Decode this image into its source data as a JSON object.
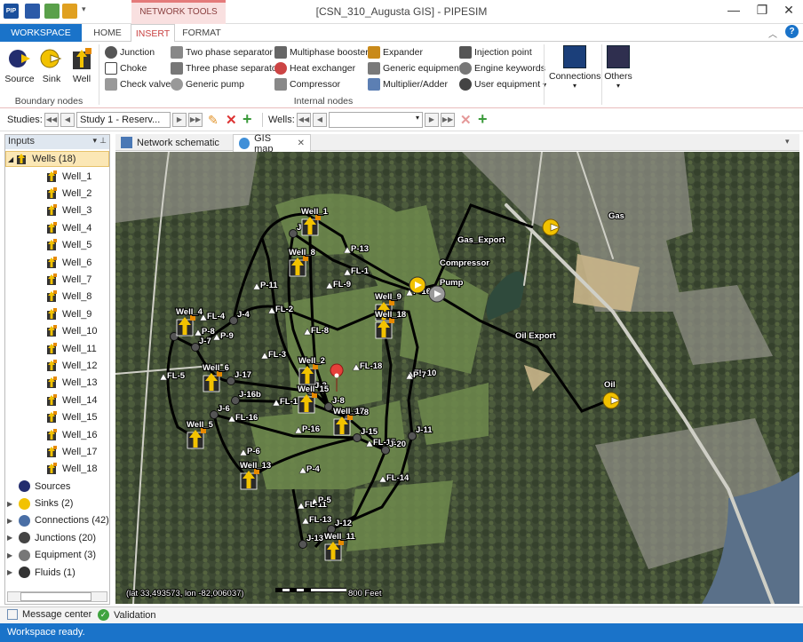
{
  "window": {
    "title": "[CSN_310_Augusta GIS] - PIPESIM",
    "context_tab": "NETWORK TOOLS"
  },
  "ribbon_tabs": [
    "WORKSPACE",
    "HOME",
    "INSERT",
    "FORMAT"
  ],
  "boundary_nodes": {
    "label": "Boundary nodes",
    "items": [
      "Source",
      "Sink",
      "Well"
    ]
  },
  "internal_nodes": {
    "label": "Internal nodes",
    "col1": [
      "Junction",
      "Choke",
      "Check valve"
    ],
    "col2": [
      "Two phase separator",
      "Three phase separator",
      "Generic pump"
    ],
    "col3": [
      "Multiphase booster",
      "Heat exchanger",
      "Compressor"
    ],
    "col4": [
      "Expander",
      "Generic equipment",
      "Multiplier/Adder"
    ],
    "col5": [
      "Injection point",
      "Engine keywords",
      "User equipment"
    ]
  },
  "connections_label": "Connections",
  "others_label": "Others",
  "studybar": {
    "studies_label": "Studies:",
    "study_value": "Study 1 - Reserv...",
    "wells_label": "Wells:",
    "wells_value": ""
  },
  "inputs": {
    "title": "Inputs",
    "wells_header": "Wells (18)",
    "wells": [
      "Well_1",
      "Well_2",
      "Well_3",
      "Well_4",
      "Well_5",
      "Well_6",
      "Well_7",
      "Well_8",
      "Well_9",
      "Well_10",
      "Well_11",
      "Well_12",
      "Well_13",
      "Well_14",
      "Well_15",
      "Well_16",
      "Well_17",
      "Well_18"
    ],
    "groups": [
      "Sources",
      "Sinks (2)",
      "Connections (42)",
      "Junctions (20)",
      "Equipment (3)",
      "Fluids (1)"
    ]
  },
  "doc_tabs": [
    "Network schematic",
    "GIS map"
  ],
  "map": {
    "coords": "(lat 33,493573, lon -82,006037)",
    "scale": "800 Feet",
    "labels": {
      "gas": "Gas",
      "gas_export": "Gas_Export",
      "compressor": "Compressor",
      "pump": "Pump",
      "oil_export": "Oil Export",
      "oil": "Oil"
    },
    "well_labels": [
      "Well_1",
      "Well_8",
      "Well_9",
      "Well_18",
      "Well_4",
      "Well_6",
      "Well_2",
      "Well_17",
      "Well_15",
      "Well_5",
      "Well_13",
      "Well_11"
    ],
    "junction_labels": [
      "J-2",
      "J-4",
      "J-5",
      "J-7",
      "J-17",
      "J-16b",
      "J-6",
      "J-3",
      "J-8",
      "J-18",
      "J-15",
      "J-11",
      "J-20",
      "J-12",
      "J-13"
    ],
    "pipe_labels": [
      "P-13",
      "FL-1",
      "P-11",
      "FL-9",
      "FL-2",
      "P-16",
      "FL-4",
      "P-8",
      "P-9",
      "FL-8",
      "FL-3",
      "FL-5",
      "FL-18",
      "FL-10",
      "P-7",
      "FL-17",
      "FL-16",
      "P-16",
      "FL-15",
      "P-6",
      "P-4",
      "FL-14",
      "FL-11",
      "FL-13",
      "P-5"
    ]
  },
  "bottom_tabs": [
    "Message center",
    "Validation"
  ],
  "status": "Workspace ready.",
  "colors": {
    "accent": "#1a73c9",
    "pipe": "#000000",
    "well_yellow": "#f2c200"
  }
}
